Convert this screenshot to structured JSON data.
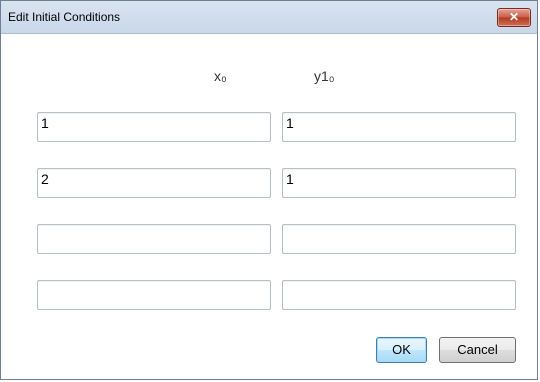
{
  "window": {
    "title": "Edit Initial Conditions",
    "close_label": "✕"
  },
  "columns": {
    "x_header": "x₀",
    "y_header": "y1₀"
  },
  "rows": [
    {
      "x": "1",
      "y": "1"
    },
    {
      "x": "2",
      "y": "1"
    },
    {
      "x": "",
      "y": ""
    },
    {
      "x": "",
      "y": ""
    }
  ],
  "buttons": {
    "ok": "OK",
    "cancel": "Cancel"
  }
}
